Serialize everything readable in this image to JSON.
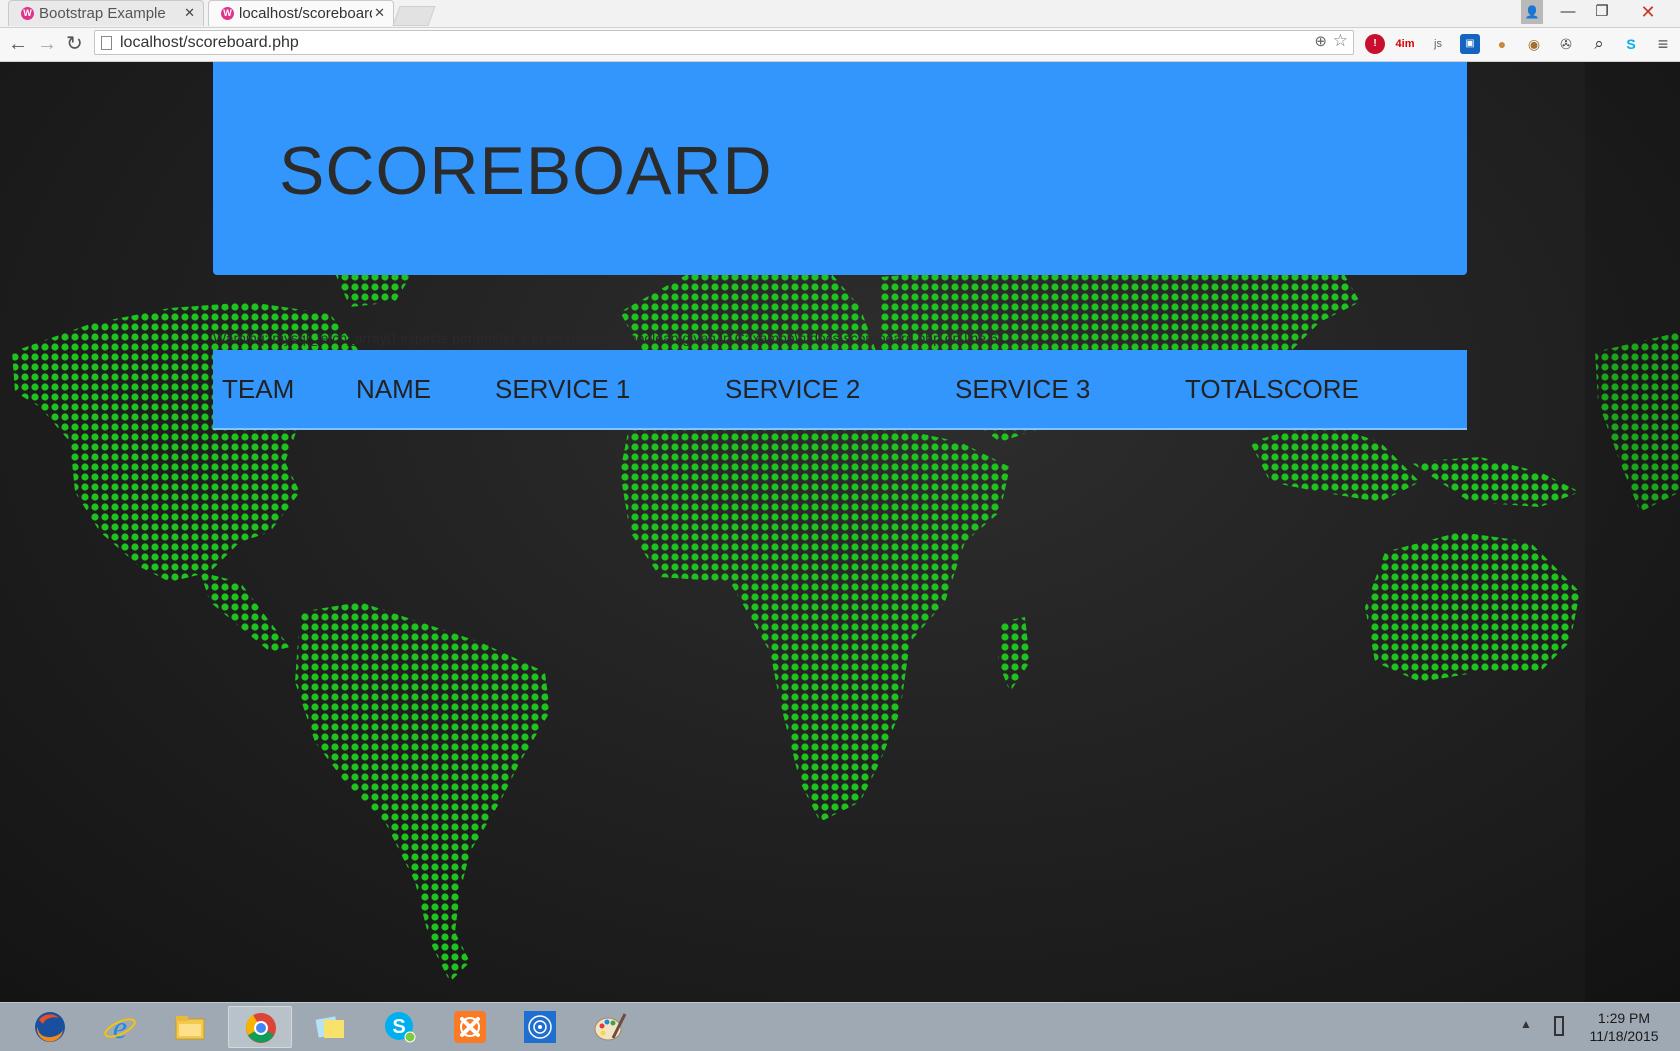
{
  "browser": {
    "tabs": [
      {
        "title": "Bootstrap Example",
        "favicon": "W",
        "active": false
      },
      {
        "title": "localhost/scoreboard.php",
        "favicon": "W",
        "active": true
      }
    ],
    "url": "localhost/scoreboard.php",
    "extensions": [
      "stop-icon",
      "4im-icon",
      "js-icon",
      "pocket-icon",
      "cookie-icon",
      "cookie-icon",
      "film-reel-icon",
      "search-icon",
      "skype-icon",
      "menu-icon"
    ],
    "ext_labels": {
      "stop": "!",
      "fourim": "4im",
      "js": "js",
      "skype": "S"
    }
  },
  "page": {
    "title": "SCOREBOARD",
    "warning": "Warning: mysql_fetch_array() expects parameter 1 to be resource, boolean given in C:\\xampp\\htdocs\\scoreboard.php on line 61",
    "columns": [
      "TEAM",
      "NAME",
      "SERVICE 1",
      "SERVICE 2",
      "SERVICE 3",
      "TOTALSCORE"
    ],
    "colors": {
      "accent": "#3396fd",
      "map_dots": "#1fc21f",
      "background": "#1c1c1c"
    }
  },
  "taskbar": {
    "apps": [
      "firefox-icon",
      "internet-explorer-icon",
      "file-explorer-icon",
      "chrome-icon",
      "sticky-notes-icon",
      "skype-icon",
      "xampp-icon",
      "network-app-icon",
      "paint-icon"
    ],
    "time": "1:29 PM",
    "date": "11/18/2015"
  }
}
